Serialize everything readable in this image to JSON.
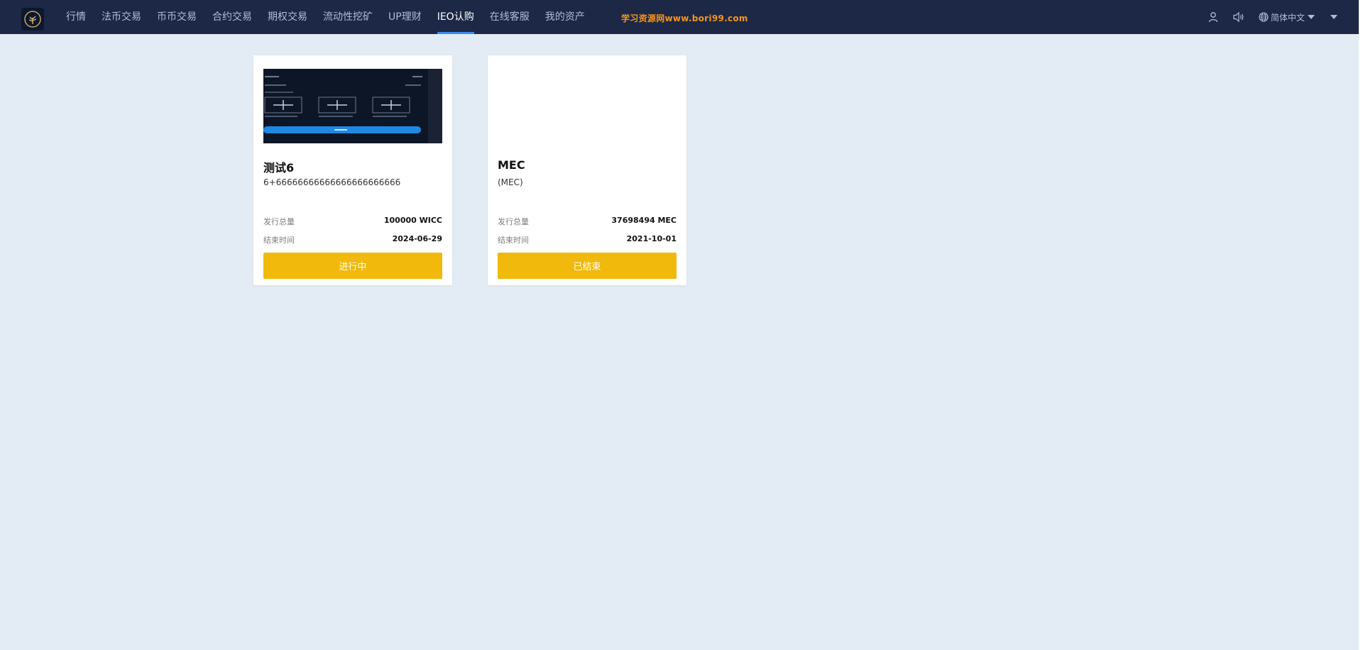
{
  "nav": {
    "items": [
      {
        "label": "行情"
      },
      {
        "label": "法币交易"
      },
      {
        "label": "币币交易"
      },
      {
        "label": "合约交易"
      },
      {
        "label": "期权交易"
      },
      {
        "label": "流动性挖矿"
      },
      {
        "label": "UP理财"
      },
      {
        "label": "IEO认购",
        "active": true
      },
      {
        "label": "在线客服"
      },
      {
        "label": "我的资产"
      }
    ],
    "watermark": "学习资源网www.bori99.com",
    "faint_text": "",
    "user_icon": "user-icon",
    "sound_icon": "speaker-icon",
    "language": "简体中文",
    "globe_icon": "globe-icon",
    "accent": "#3a8bf0",
    "bg": "#1c2846"
  },
  "cards": [
    {
      "title": "测试6",
      "description": "6+66666666666666666666666",
      "total_label": "发行总量",
      "total_value": "100000 WICC",
      "end_label": "结束时间",
      "end_value": "2024-06-29",
      "button": "进行中",
      "has_image": true
    },
    {
      "title": "MEC",
      "description": "(MEC)",
      "total_label": "发行总量",
      "total_value": "37698494 MEC",
      "end_label": "结束时间",
      "end_value": "2021-10-01",
      "button": "已结束",
      "has_image": false
    }
  ],
  "colors": {
    "button": "#f0b90b",
    "page_bg": "#e3ebf5"
  }
}
